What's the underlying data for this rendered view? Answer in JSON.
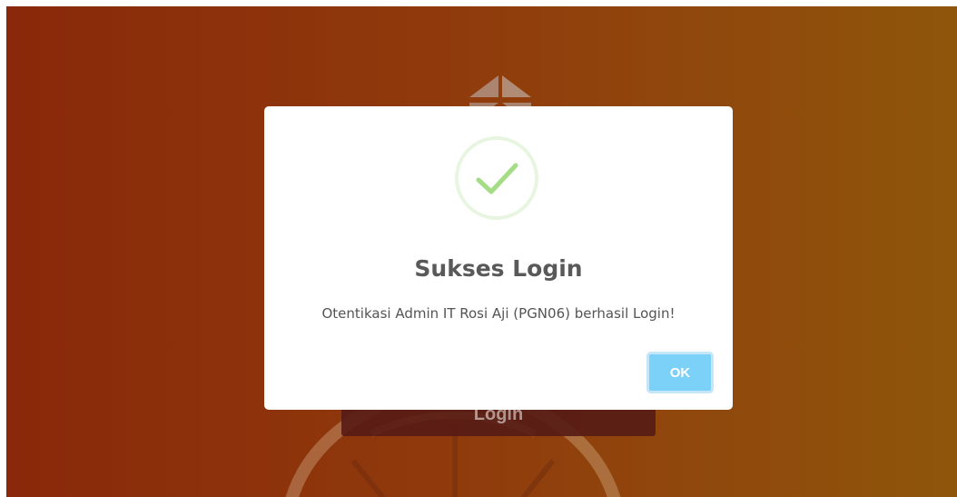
{
  "dialog": {
    "title": "Sukses Login",
    "message": "Otentikasi Admin IT Rosi Aji (PGN06) berhasil Login!",
    "ok_label": "OK",
    "icon": "success-check-icon"
  },
  "background": {
    "login_button_label": "Login",
    "logo_icon": "triangle-logo-icon"
  },
  "colors": {
    "gradient_start": "#8f2a0b",
    "gradient_end": "#955a0c",
    "success_check": "#a5dc86",
    "ok_button": "#7cd1f9",
    "title_text": "#595959"
  }
}
